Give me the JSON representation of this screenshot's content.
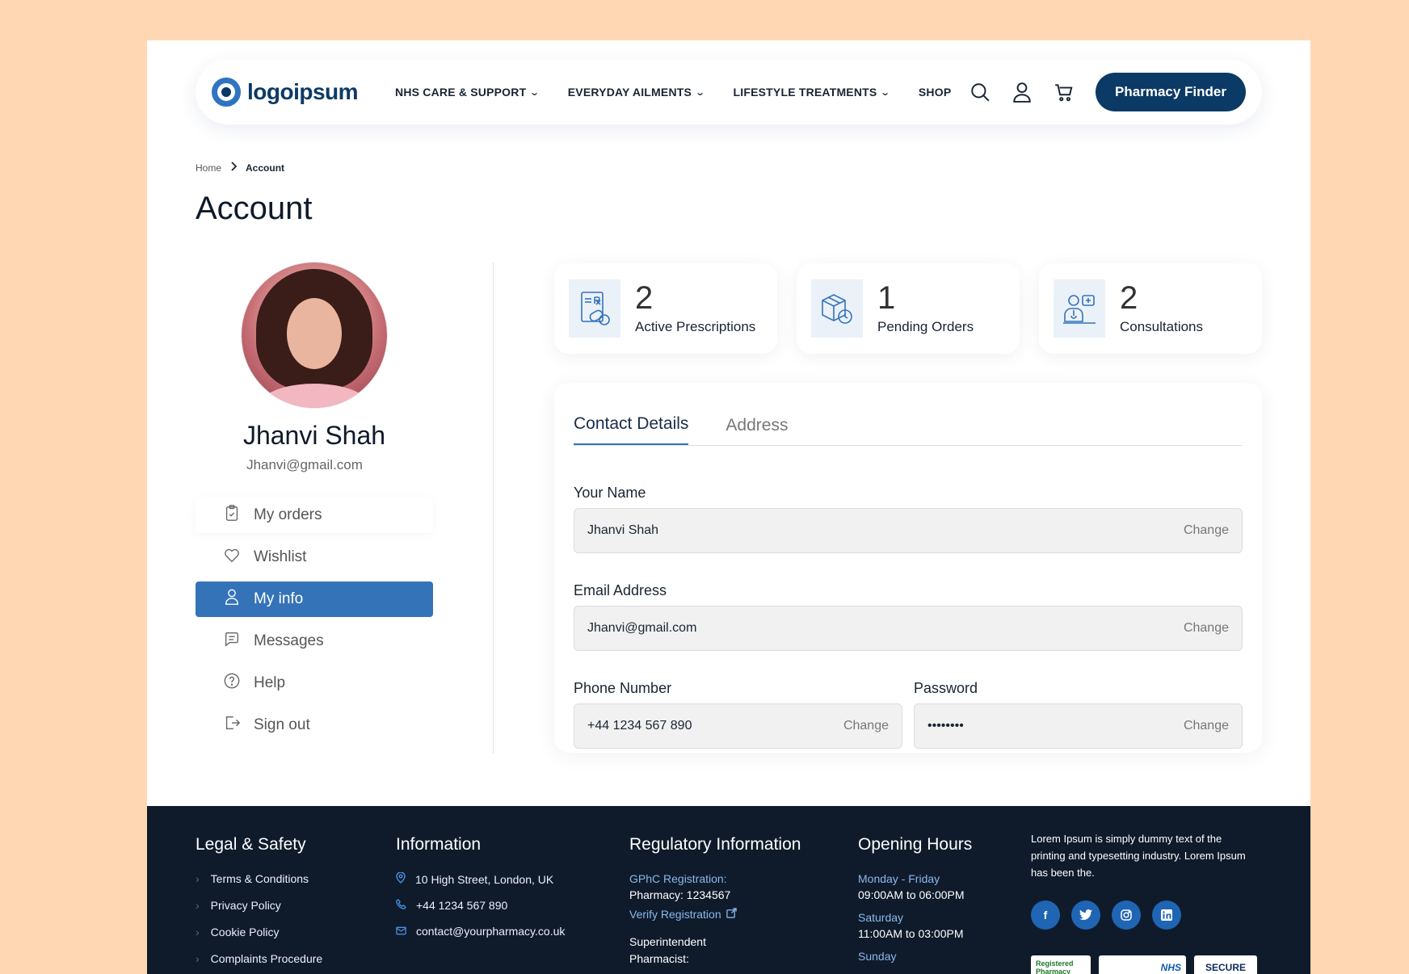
{
  "nav": {
    "logo_text": "logoipsum",
    "menu": [
      {
        "label": "NHS CARE & SUPPORT",
        "has_dropdown": true
      },
      {
        "label": "EVERYDAY AILMENTS",
        "has_dropdown": true
      },
      {
        "label": "LIFESTYLE TREATMENTS",
        "has_dropdown": true
      },
      {
        "label": "SHOP",
        "has_dropdown": false
      }
    ],
    "icons": [
      "search-icon",
      "user-icon",
      "cart-icon"
    ],
    "cta_label": "Pharmacy Finder"
  },
  "breadcrumb": {
    "home": "Home",
    "current": "Account"
  },
  "page_title": "Account",
  "profile": {
    "name": "Jhanvi Shah",
    "email": "Jhanvi@gmail.com",
    "menu": [
      {
        "label": "My orders",
        "icon": "clipboard-icon",
        "active": false
      },
      {
        "label": "Wishlist",
        "icon": "heart-icon",
        "active": false
      },
      {
        "label": "My info",
        "icon": "user-icon",
        "active": true
      },
      {
        "label": "Messages",
        "icon": "chat-icon",
        "active": false
      },
      {
        "label": "Help",
        "icon": "help-icon",
        "active": false
      },
      {
        "label": "Sign out",
        "icon": "logout-icon",
        "active": false
      }
    ]
  },
  "stats": [
    {
      "value": "2",
      "label": "Active Prescriptions",
      "icon": "prescription-icon"
    },
    {
      "value": "1",
      "label": "Pending Orders",
      "icon": "package-clock-icon"
    },
    {
      "value": "2",
      "label": "Consultations",
      "icon": "doctor-icon"
    }
  ],
  "form": {
    "tabs": [
      {
        "label": "Contact Details",
        "active": true
      },
      {
        "label": "Address",
        "active": false
      }
    ],
    "change_label": "Change",
    "name": {
      "label": "Your Name",
      "value": "Jhanvi Shah"
    },
    "email": {
      "label": "Email Address",
      "value": "Jhanvi@gmail.com"
    },
    "phone": {
      "label": "Phone Number",
      "value": "+44 1234 567 890"
    },
    "password": {
      "label": "Password",
      "value": "••••••••"
    }
  },
  "footer": {
    "legal": {
      "title": "Legal & Safety",
      "links": [
        "Terms & Conditions",
        "Privacy Policy",
        "Cookie Policy",
        "Complaints Procedure"
      ]
    },
    "information": {
      "title": "Information",
      "address": "10 High Street, London, UK",
      "phone": "+44 1234 567 890",
      "email": "contact@yourpharmacy.co.uk"
    },
    "regulatory": {
      "title": "Regulatory Information",
      "gphc_label": "GPhC Registration:",
      "gphc_value": "Pharmacy: 1234567",
      "verify": "Verify Registration",
      "superintendent": "Superintendent Pharmacist:"
    },
    "hours": {
      "title": "Opening Hours",
      "weekday_label": "Monday - Friday",
      "weekday_value": "09:00AM to 06:00PM",
      "saturday_label": "Saturday",
      "saturday_value": "11:00AM to 03:00PM",
      "sunday_label": "Sunday"
    },
    "about": "Lorem Ipsum is simply dummy text of the printing and typesetting industry. Lorem Ipsum has been the.",
    "badges": [
      "Registered Pharmacy",
      "NHS",
      "SECURE"
    ],
    "colors": {
      "background": "#0f1b2b",
      "accent": "#8ab8ec",
      "social": "#1f65b4"
    }
  },
  "colors": {
    "primary": "#0c3a66",
    "active": "#3573b9",
    "page_bg": "#FFD8B3"
  }
}
